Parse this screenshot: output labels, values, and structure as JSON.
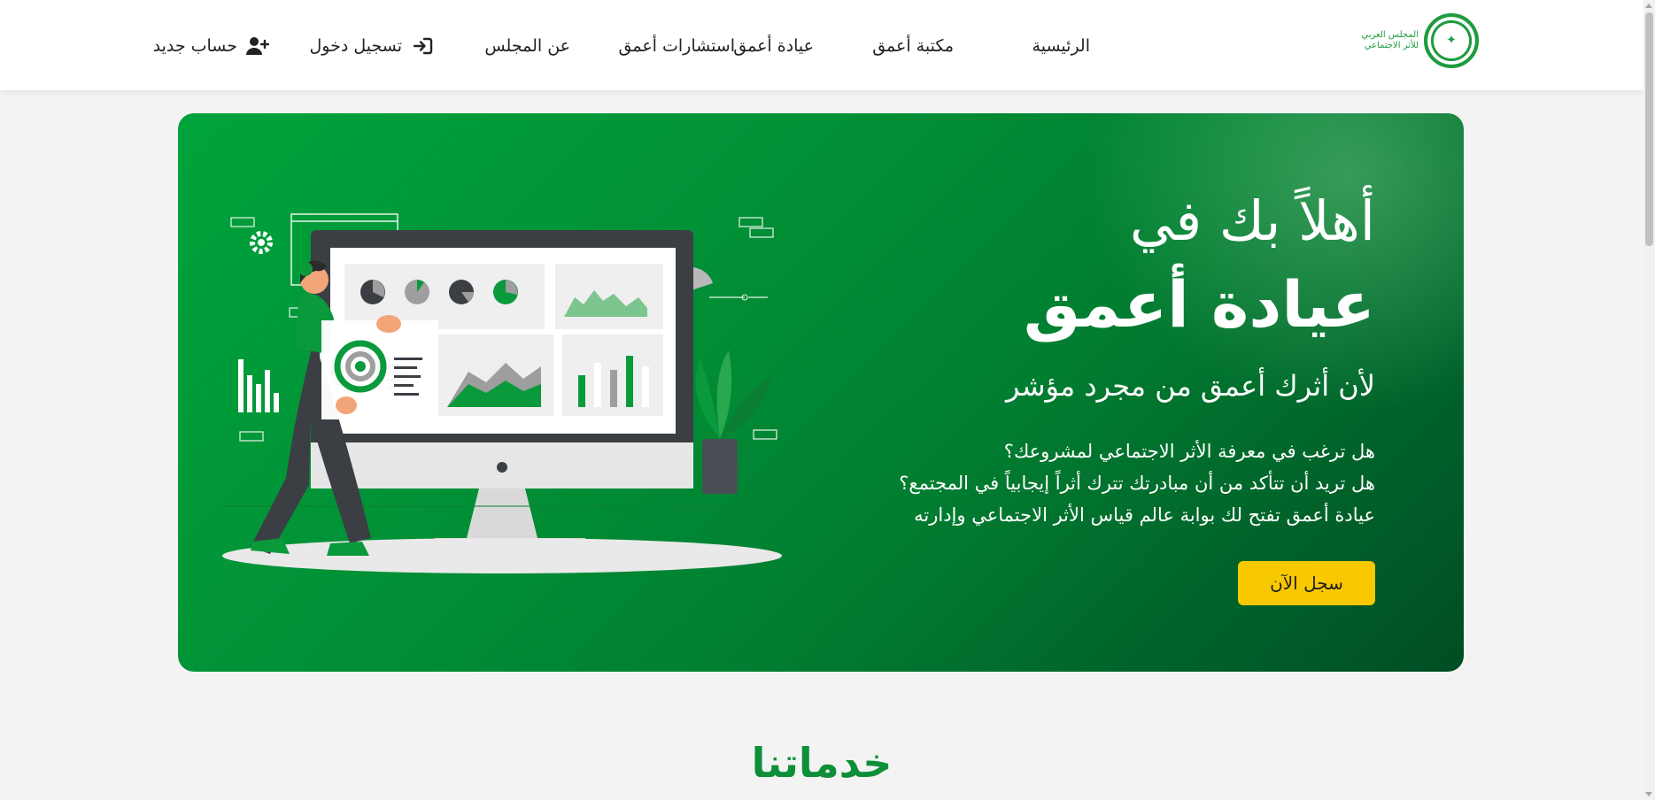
{
  "logo": {
    "line1": "المجلس العربي",
    "line2": "للأثر الاجتماعي"
  },
  "nav": {
    "home": "الرئيسية",
    "library": "مكتبة أعمق",
    "clinic": "عيادة أعمق",
    "consultations": "استشارات أعمق",
    "about": "عن المجلس",
    "login": "تسجيل دخول",
    "register": "حساب جديد",
    "login_icon": "sign-in-icon",
    "register_icon": "user-plus-icon"
  },
  "hero": {
    "welcome": "أهلاً بك في",
    "title": "عيادة أعمق",
    "tagline": "لأن أثرك أعمق من مجرد مؤشر",
    "questions": [
      "هل ترغب في معرفة الأثر الاجتماعي لمشروعك؟",
      "هل تريد أن تتأكد من أن مبادرتك تترك أثراً إيجابياً في المجتمع؟",
      "عيادة أعمق تفتح لك بوابة عالم قياس الأثر الاجتماعي وإدارته"
    ],
    "cta_label": "سجل الآن",
    "illustration": "analytics-dashboard-illustration"
  },
  "services": {
    "title": "خدماتنا"
  },
  "colors": {
    "brand_green": "#019437",
    "cta_yellow": "#f8c800",
    "section_title_green": "#0d8f38"
  }
}
